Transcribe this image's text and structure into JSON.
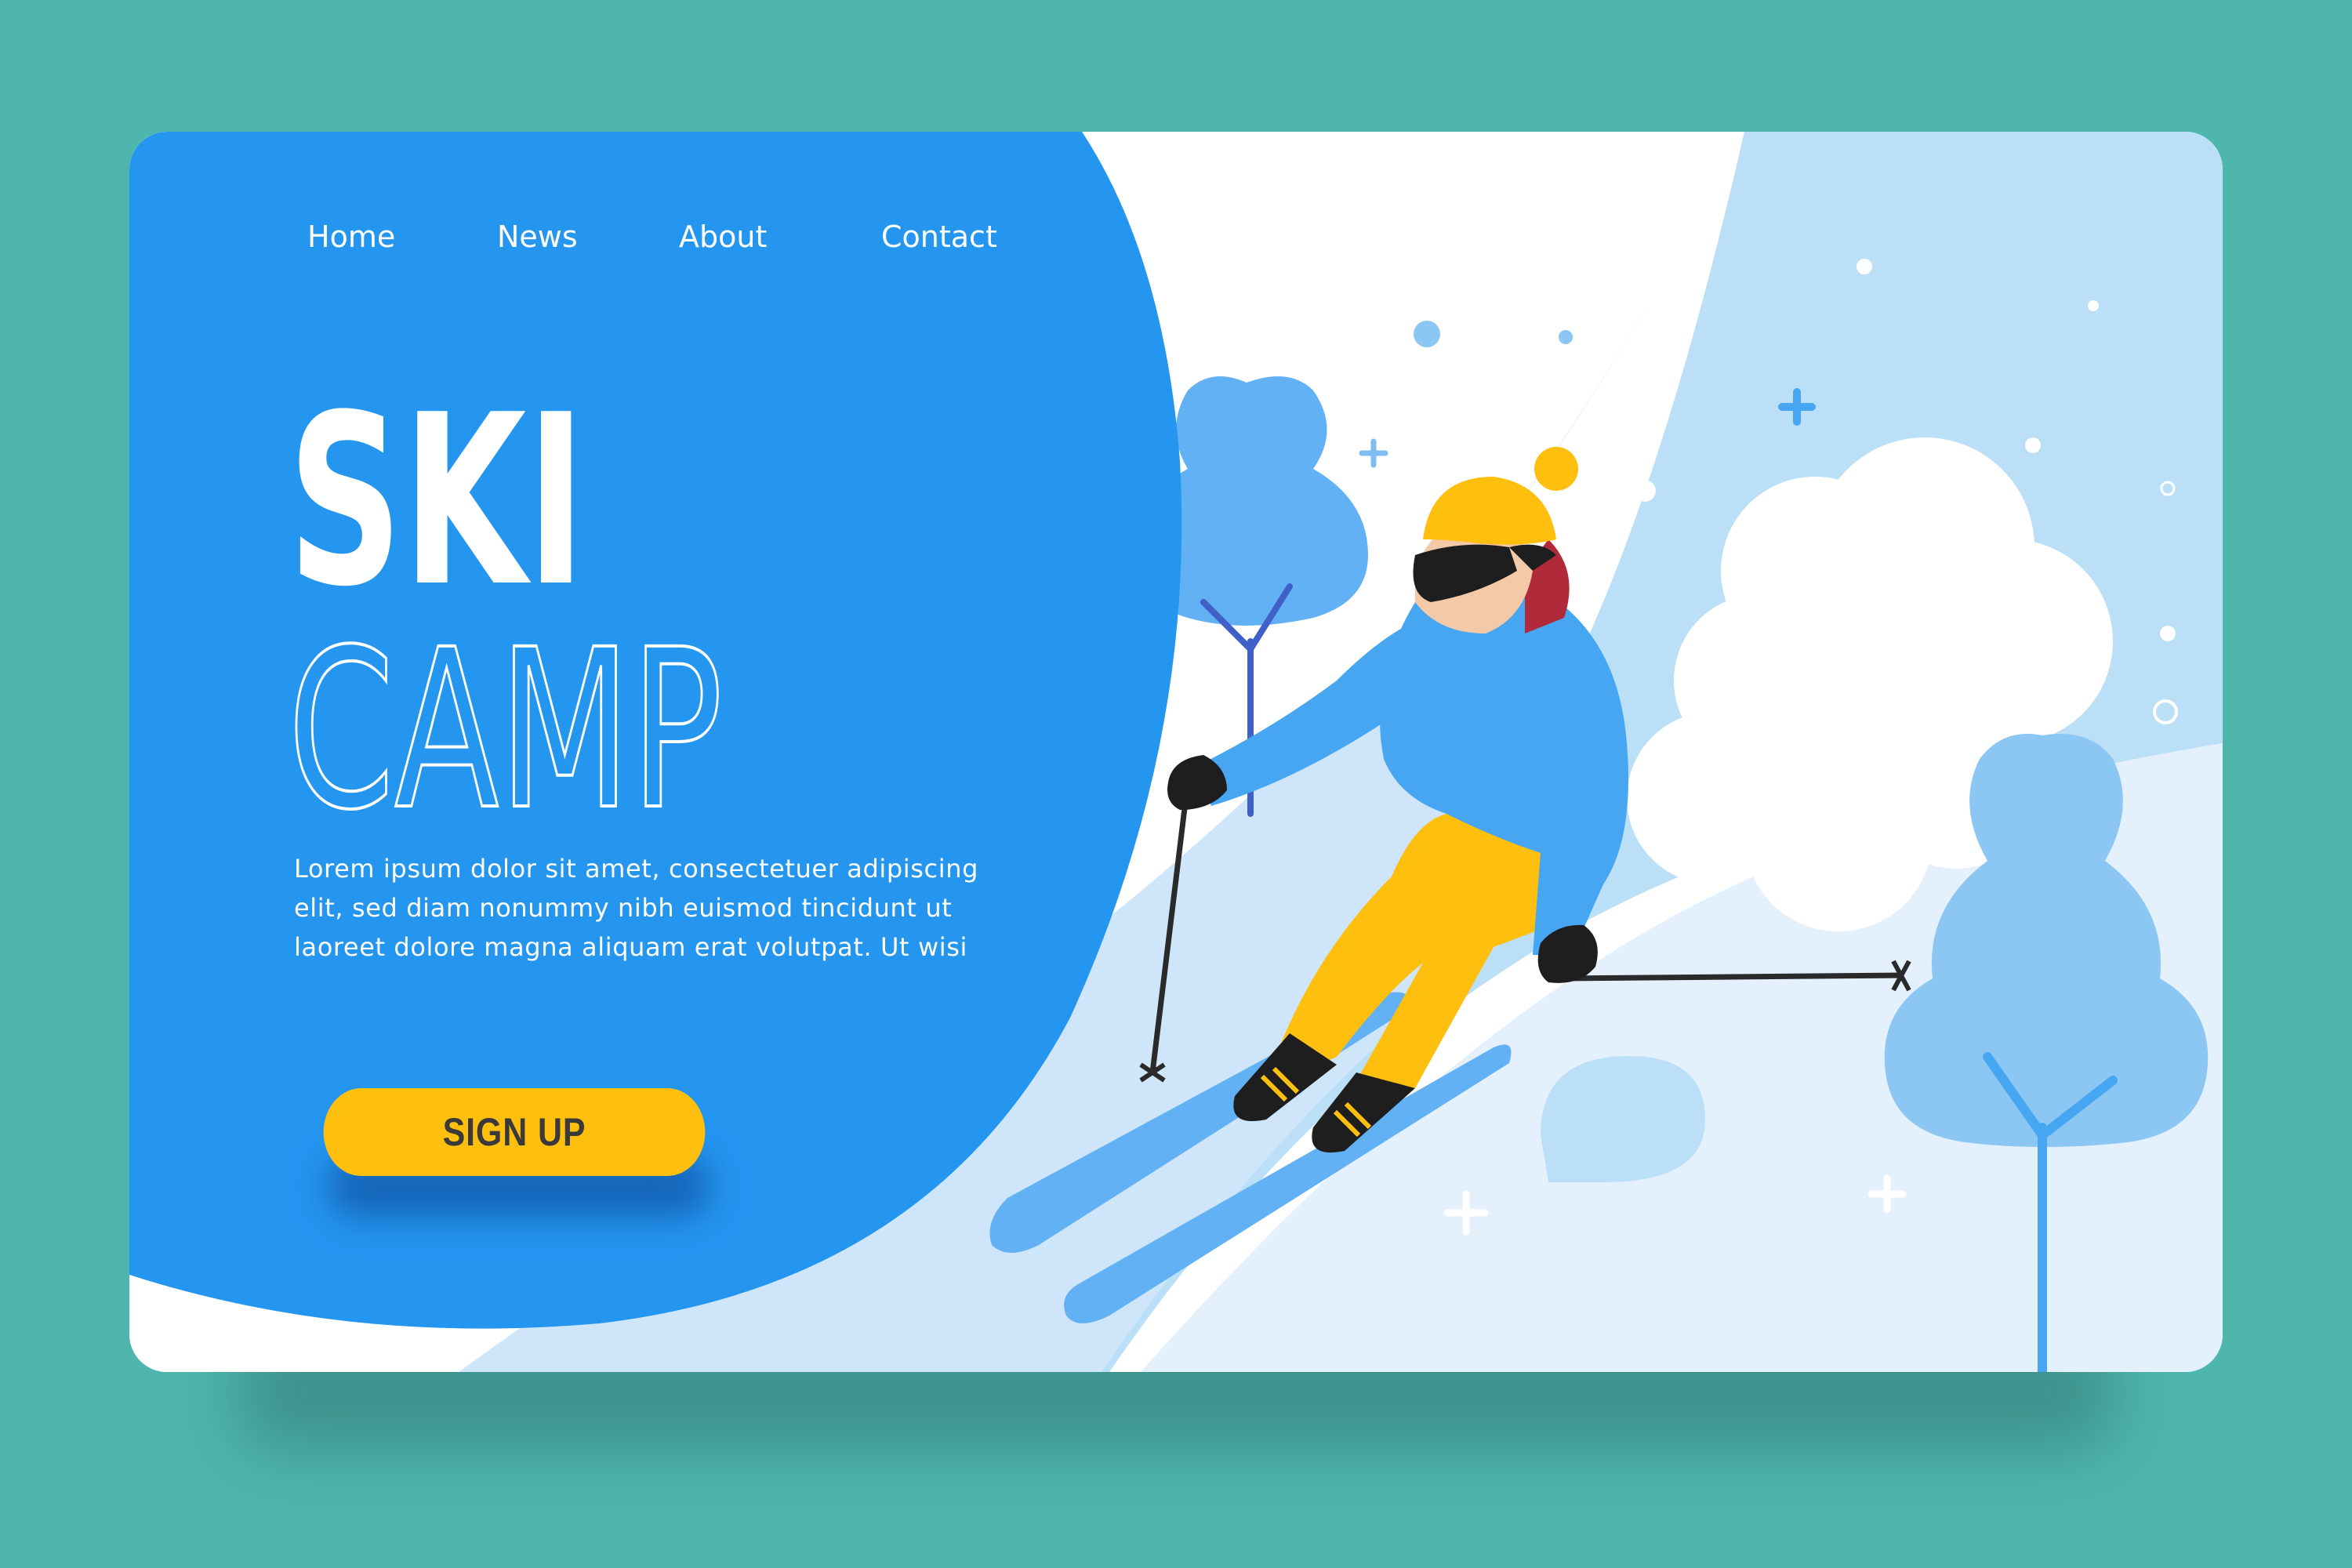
{
  "nav": {
    "items": [
      {
        "label": "Home"
      },
      {
        "label": "News"
      },
      {
        "label": "About"
      },
      {
        "label": "Contact"
      }
    ]
  },
  "hero": {
    "title_line1": "SKI",
    "title_line2": "CAMP",
    "body": "Lorem ipsum dolor sit amet, consectetuer adipiscing elit, sed diam nonummy nibh euismod tincidunt ut laoreet dolore magna aliquam erat volutpat. Ut wisi",
    "body_lines": [
      "Lorem ipsum dolor sit amet, consectetuer adipiscing",
      "elit, sed diam nonummy nibh euismod tincidunt ut",
      "laoreet dolore magna aliquam erat volutpat. Ut wisi"
    ],
    "cta_label": "SIGN UP"
  },
  "illustration": {
    "subject": "skier",
    "icons": [
      "snowflake-plus-icon",
      "snow-dot-icon",
      "tree-icon",
      "ski-pole-icon"
    ]
  },
  "colors": {
    "page_background": "#4fb6ad",
    "hero_blue": "#2496f0",
    "button_yellow": "#ffbf0f",
    "snow_light": "#b9dcf7",
    "snow_mid": "#8cc6f3",
    "jacket_blue": "#47a6f1",
    "pants_yellow": "#ffbf0f"
  }
}
